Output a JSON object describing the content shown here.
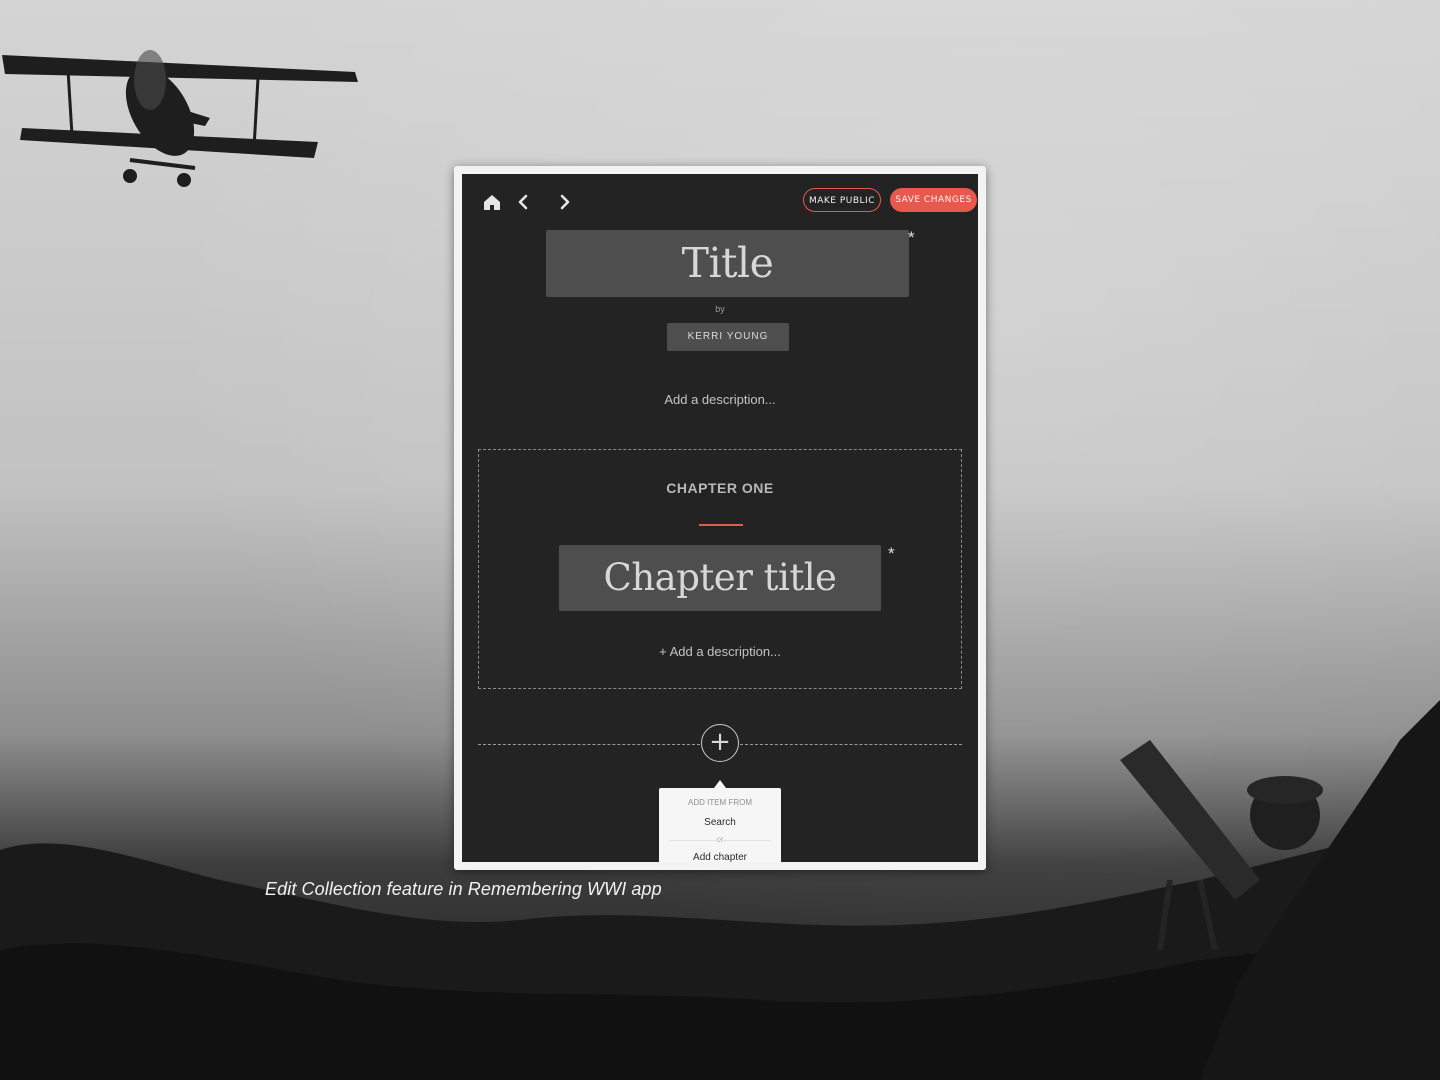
{
  "caption": "Edit Collection feature in Remembering WWI app",
  "toolbar": {
    "home_icon": "home-icon",
    "back_icon": "chevron-left-icon",
    "forward_icon": "chevron-right-icon",
    "make_public_label": "MAKE PUBLIC",
    "save_changes_label": "SAVE CHANGES",
    "accent_color": "#e8594d"
  },
  "collection": {
    "title_placeholder": "Title",
    "required_marker": "*",
    "by_label": "by",
    "author": "KERRI YOUNG",
    "description_placeholder": "Add a description..."
  },
  "chapter": {
    "label": "CHAPTER ONE",
    "title_placeholder": "Chapter title",
    "required_marker": "*",
    "description_placeholder": "+ Add a description..."
  },
  "add_menu": {
    "add_icon": "plus-circle-icon",
    "add_glyph": "+",
    "heading": "ADD ITEM FROM",
    "option_search": "Search",
    "or_label": "or",
    "option_add_chapter": "Add chapter"
  }
}
